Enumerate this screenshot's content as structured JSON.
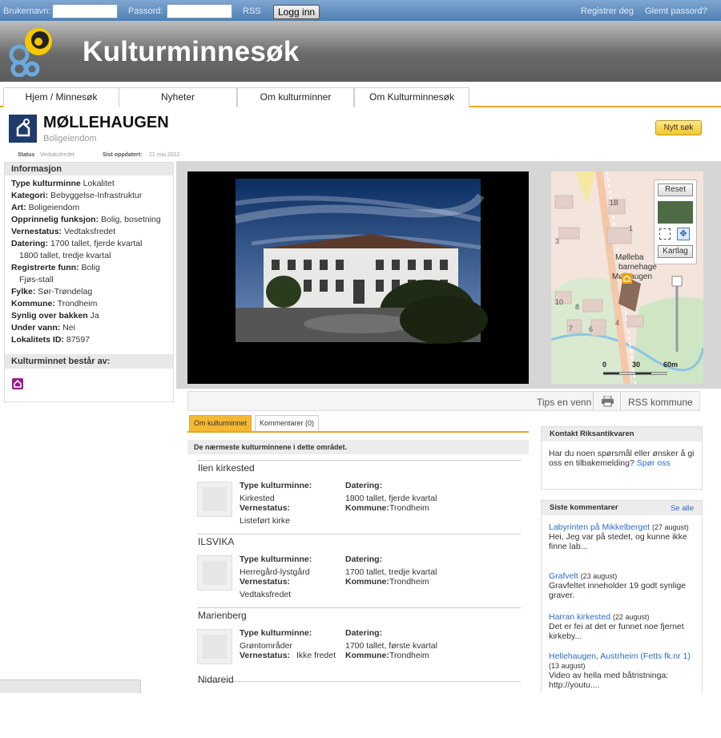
{
  "topbar": {
    "username_label": "Brukernavn:",
    "password_label": "Passord:",
    "rss": "RSS",
    "login_button": "Logg inn",
    "register": "Registrer deg",
    "forgot": "Glemt passord?"
  },
  "header": {
    "title": "Kulturminnesøk"
  },
  "tabs": [
    "Hjem / Minnesøk",
    "Nyheter",
    "Om kulturminner",
    "Om Kulturminnesøk"
  ],
  "page": {
    "title": "MØLLEHAUGEN",
    "subtitle": "Boligeiendom",
    "new_search": "Nytt søk",
    "status_label": "Status",
    "status_value": "Vedtaksfredet",
    "updated_label": "Sist oppdatert:",
    "updated_value": "21 mai 2012"
  },
  "info": {
    "heading": "Informasjon",
    "rows": [
      {
        "k": "Type kulturminne",
        "v": " Lokalitet"
      },
      {
        "k": "Kategori:",
        "v": " Bebyggelse-Infrastruktur"
      },
      {
        "k": "Art:",
        "v": " Boligeiendom"
      },
      {
        "k": "Opprinnelig funksjon:",
        "v": " Bolig, bosetning"
      },
      {
        "k": "Vernestatus:",
        "v": " Vedtaksfredet"
      },
      {
        "k": "Datering:",
        "v": " 1700 tallet, fjerde kvartal"
      },
      {
        "k": "",
        "v": "1800 tallet, tredje kvartal",
        "indent": true
      },
      {
        "k": "Registrerte funn:",
        "v": " Bolig"
      },
      {
        "k": "",
        "v": "Fjøs-stall",
        "indent": true
      },
      {
        "k": "Fylke:",
        "v": " Sør-Trøndelag"
      },
      {
        "k": "Kommune:",
        "v": " Trondheim"
      },
      {
        "k": "Synlig over bakken",
        "v": " Ja"
      },
      {
        "k": "Under vann:",
        "v": " Nei"
      },
      {
        "k": "Lokalitets ID:",
        "v": " 87597"
      }
    ],
    "consists_heading": "Kulturminnet består av:"
  },
  "map": {
    "reset": "Reset",
    "kartlag": "Kartlag",
    "labels": {
      "b1": "1B",
      "b2": "1",
      "b3": "3",
      "b4": "10",
      "b5": "8",
      "b6": "6",
      "b7": "7",
      "b8": "4",
      "mol1": "Mølleba",
      "mol2": "barnehage",
      "mol3": "Mølhaugen"
    },
    "scale": [
      "0",
      "30",
      "60m"
    ]
  },
  "toolbar": {
    "tips": "Tips en venn",
    "rss": "RSS kommune"
  },
  "content_tabs": [
    "Om kulturminnet",
    "Kommentarer (0)"
  ],
  "nearby": {
    "heading": "De nærmeste kulturminnene i dette området.",
    "type_label": "Type kulturminne:",
    "datering_label": "Datering:",
    "verne_label": "Vernestatus:",
    "kommune_label": "Kommune:",
    "items": [
      {
        "name": "Ilen kirkested",
        "type": "Kirkested",
        "datering": "1800 tallet, fjerde kvartal",
        "verne": "Listeført kirke",
        "kommune": "Trondheim"
      },
      {
        "name": "ILSVIKA",
        "type": "Herregård-lystgård",
        "datering": "1700 tallet, tredje kvartal",
        "verne": "Vedtaksfredet",
        "kommune": "Trondheim"
      },
      {
        "name": "Marienberg",
        "type": "Grøntområder",
        "datering": "1700 tallet, første kvartal",
        "verne": "Ikke fredet",
        "kommune": "Trondheim"
      },
      {
        "name": "Nidareid"
      }
    ]
  },
  "contact": {
    "heading": "Kontakt Riksantikvaren",
    "text": "Har du noen spørsmål eller ønsker å gi oss en tilbakemelding?",
    "link": "Spør oss"
  },
  "comments": {
    "heading": "Siste kommentarer",
    "see_all": "Se alle",
    "items": [
      {
        "title": "Labyrinten på Mikkelberget",
        "date": "(27 august)",
        "text": "Hei, Jeg var på stedet, og kunne ikke finne lab..."
      },
      {
        "title": "Grafvelt",
        "date": "(23 august)",
        "text": "Gravfeltet inneholder 19 godt synlige graver."
      },
      {
        "title": "Harran kirkested",
        "date": "(22 august)",
        "text": "Det er fei at det er funnet noe fjernet kirkeby..."
      },
      {
        "title": "Hellehaugen, Austrheim (Fetts fk.nr 1)",
        "date": "(13 august)",
        "text": "Video av hella med båtristninga: http://youtu...."
      }
    ]
  },
  "colors": {
    "accent": "#e8a72c",
    "link": "#2a6cc8",
    "topbar": "#4f7fb3"
  }
}
